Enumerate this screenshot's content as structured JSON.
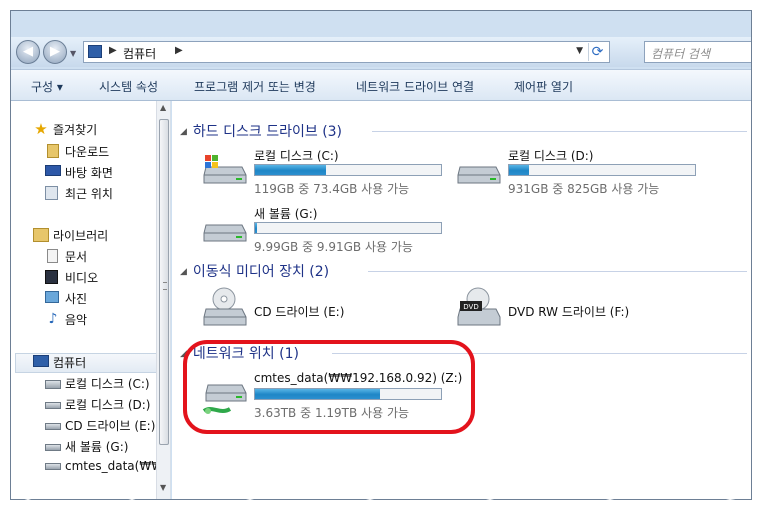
{
  "address": {
    "crumb": "컴퓨터"
  },
  "search": {
    "placeholder": "컴퓨터 검색"
  },
  "toolbar": {
    "organize": "구성 ▾",
    "system_properties": "시스템 속성",
    "uninstall": "프로그램 제거 또는 변경",
    "map_drive": "네트워크 드라이브 연결",
    "control_panel": "제어판 열기"
  },
  "nav": {
    "favorites": "즐겨찾기",
    "downloads": "다운로드",
    "desktop": "바탕 화면",
    "recent": "최근 위치",
    "libraries": "라이브러리",
    "documents": "문서",
    "videos": "비디오",
    "pictures": "사진",
    "music": "음악",
    "computer": "컴퓨터",
    "drive_c": "로컬 디스크 (C:)",
    "drive_d": "로컬 디스크 (D:)",
    "drive_e": "CD 드라이브 (E:)",
    "drive_g": "새 볼륨 (G:)",
    "drive_z": "cmtes_data(₩₩1"
  },
  "groups": {
    "hdd": "하드 디스크 드라이브 (3)",
    "removable": "이동식 미디어 장치 (2)",
    "network": "네트워크 위치 (1)"
  },
  "drives": {
    "c": {
      "name": "로컬 디스크 (C:)",
      "free": "119GB 중 73.4GB 사용 가능",
      "used_fraction": 0.38
    },
    "d": {
      "name": "로컬 디스크 (D:)",
      "free": "931GB 중 825GB 사용 가능",
      "used_fraction": 0.11
    },
    "g": {
      "name": "새 볼륨 (G:)",
      "free": "9.99GB 중 9.91GB 사용 가능",
      "used_fraction": 0.01
    },
    "e": {
      "name": "CD 드라이브 (E:)"
    },
    "f": {
      "name": "DVD RW 드라이브 (F:)"
    },
    "z": {
      "name": "cmtes_data(₩₩192.168.0.92) (Z:)",
      "free": "3.63TB 중 1.19TB 사용 가능",
      "used_fraction": 0.67
    }
  },
  "icons": {
    "dvd_label": "DVD"
  },
  "colors": {
    "annotation": "#e3131c",
    "bar_fill": "#1e86c6",
    "group_header": "#1e3287"
  }
}
